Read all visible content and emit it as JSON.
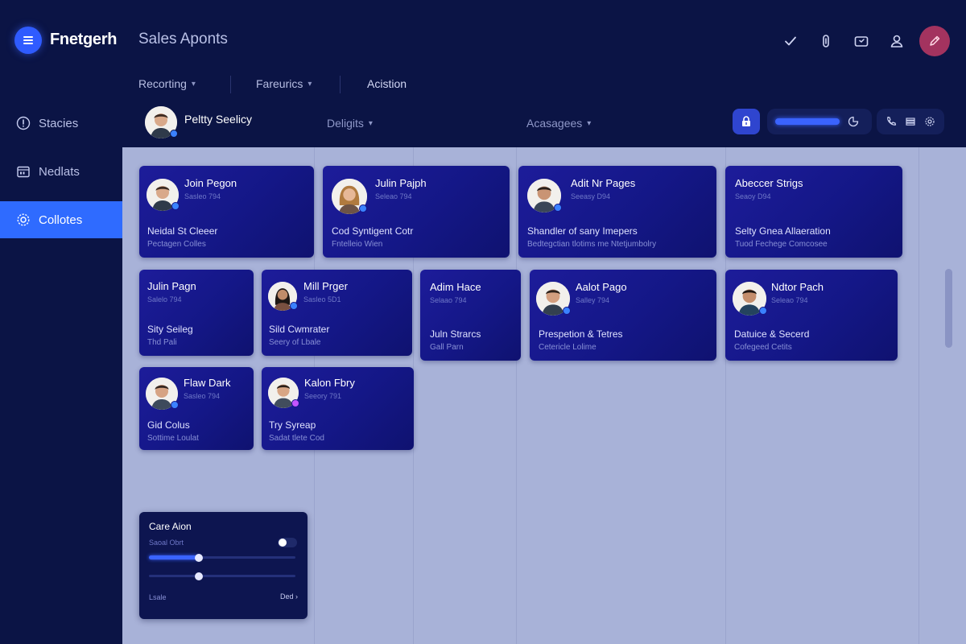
{
  "app": {
    "brand": "Fnetgerh",
    "title": "Sales Aponts"
  },
  "topbar": {
    "icons": [
      "check-icon",
      "paperclip-icon",
      "inbox-icon",
      "user-icon",
      "pen-icon"
    ]
  },
  "filters": [
    {
      "label": "Recorting",
      "chevron": "▾"
    },
    {
      "label": "Fareurics",
      "chevron": "▾"
    },
    {
      "label": "Acistion",
      "chevron": ""
    }
  ],
  "sidebar": {
    "items": [
      {
        "label": "Stacies",
        "icon": "alert-icon",
        "active": false
      },
      {
        "label": "Nedlats",
        "icon": "calendar-icon",
        "active": false
      },
      {
        "label": "Collotes",
        "icon": "gear-icon",
        "active": true
      }
    ]
  },
  "header": {
    "user_name": "Peltty Seelicy",
    "filter_a": "Deligits",
    "filter_b": "Acasagees",
    "chevron": "▾"
  },
  "cards": [
    {
      "name": "Join Pegon",
      "sub": "Sasleo 794",
      "role": "Neidal St Cleeer",
      "team": "Pectagen Colles",
      "avatar": "male-1",
      "badge": "#3b82ff"
    },
    {
      "name": "Julin Pajph",
      "sub": "Seleao 794",
      "role": "Cod Syntigent Cotr",
      "team": "Fntelleio Wien",
      "avatar": "female-1",
      "badge": "#3b82ff"
    },
    {
      "name": "Adit Nr Pages",
      "sub": "Seeasy D94",
      "role": "Shandler of sany Imepers",
      "team": "Bedtegctian tlotims me Ntetjumbolry",
      "avatar": "male-2",
      "badge": "#3b82ff"
    },
    {
      "name": "Abeccer Strigs",
      "sub": "Seaoy D94",
      "role": "Selty Gnea Allaeration",
      "team": "Tuod Fechege Comcosee",
      "avatar": "",
      "badge": ""
    },
    {
      "name": "Julin Pagn",
      "sub": "Salelo 794",
      "role": "Sity Seileg",
      "team": "Thd Pali",
      "avatar": "",
      "badge": ""
    },
    {
      "name": "Mill Prger",
      "sub": "Sasleo 5D1",
      "role": "Sild Cwmrater",
      "team": "Seery of Lbale",
      "avatar": "female-2",
      "badge": "#3b82ff"
    },
    {
      "name": "Adim Hace",
      "sub": "Selaao 794",
      "role": "Juln Strarcs",
      "team": "Gall Parn",
      "avatar": "",
      "badge": ""
    },
    {
      "name": "Aalot Pago",
      "sub": "Salley 794",
      "role": "Prespetion & Tetres",
      "team": "Cetericle Lolime",
      "avatar": "male-3",
      "badge": "#3b82ff"
    },
    {
      "name": "Ndtor Pach",
      "sub": "Seleao 794",
      "role": "Datuice & Secerd",
      "team": "Cofegeed Cetits",
      "avatar": "male-4",
      "badge": "#3b82ff"
    },
    {
      "name": "Flaw Dark",
      "sub": "Sasleo 794",
      "role": "Gid Colus",
      "team": "Sottime Loulat",
      "avatar": "male-5",
      "badge": "#3b82ff"
    },
    {
      "name": "Kalon Fbry",
      "sub": "Seeory 791",
      "role": "Try Syreap",
      "team": "Sadat tlete Cod",
      "avatar": "male-6",
      "badge": "#c455ff"
    }
  ],
  "panel": {
    "title": "Care Aion",
    "sub": "Saoal Obrt",
    "toggle_on": false,
    "slider_a": 0.34,
    "slider_b": 0.34,
    "left_label": "Lsale",
    "right_label": "Ded ›"
  },
  "colors": {
    "background": "#0b1445",
    "board": "#a8b2d8",
    "accent": "#2f6bff",
    "card": "#141787",
    "pen_button": "#a3335f"
  }
}
